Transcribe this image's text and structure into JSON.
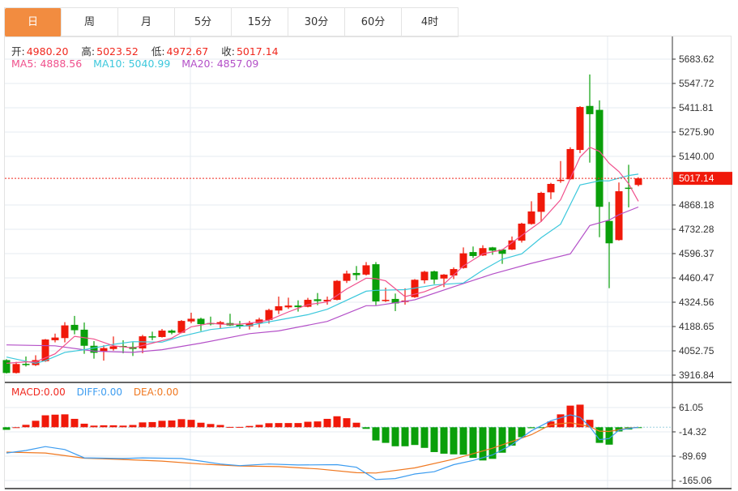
{
  "tabs": [
    {
      "label": "日",
      "active": true
    },
    {
      "label": "周"
    },
    {
      "label": "月"
    },
    {
      "label": "5分"
    },
    {
      "label": "15分"
    },
    {
      "label": "30分"
    },
    {
      "label": "60分"
    },
    {
      "label": "4时"
    }
  ],
  "ohlc_info": {
    "open_label": "开:",
    "open": "4980.20",
    "high_label": "高:",
    "high": "5023.52",
    "low_label": "低:",
    "low": "4972.67",
    "close_label": "收:",
    "close": "5017.14"
  },
  "ma_info": {
    "ma5": "MA5: 4888.56",
    "ma10": "MA10: 5040.99",
    "ma20": "MA20: 4857.09"
  },
  "macd_info": {
    "macd": "MACD:0.00",
    "diff": "DIFF:0.00",
    "dea": "DEA:0.00"
  },
  "colors": {
    "up": "#f0190a",
    "down": "#0a9f0a",
    "ma5": "#f0508c",
    "ma10": "#3cc8dc",
    "ma20": "#b450c8",
    "diff": "#3c9cf0",
    "dea": "#f07820",
    "accent": "#f28c40"
  },
  "chart_data": [
    {
      "type": "candlestick",
      "yticks": [
        "5683.62",
        "5547.72",
        "5411.81",
        "5275.90",
        "5140.00",
        "4868.18",
        "4732.28",
        "4596.37",
        "4460.47",
        "4324.56",
        "4188.65",
        "4052.75",
        "3916.84"
      ],
      "ylim": [
        3916.84,
        5683.62
      ],
      "last_price": "5017.14",
      "ohlc": [
        [
          4001,
          3929,
          4006,
          3926
        ],
        [
          3929,
          3979,
          3991,
          3926
        ],
        [
          3980,
          3973,
          4021,
          3965
        ],
        [
          3973,
          4001,
          4028,
          3968
        ],
        [
          3995,
          4116,
          4119,
          3991
        ],
        [
          4112,
          4127,
          4149,
          4100
        ],
        [
          4124,
          4195,
          4213,
          4100
        ],
        [
          4198,
          4168,
          4248,
          4145
        ],
        [
          4171,
          4081,
          4211,
          4036
        ],
        [
          4081,
          4042,
          4107,
          4009
        ],
        [
          4048,
          4068,
          4084,
          3998
        ],
        [
          4063,
          4078,
          4133,
          4054
        ],
        [
          4080,
          4074,
          4112,
          4039
        ],
        [
          4075,
          4063,
          4101,
          4024
        ],
        [
          4066,
          4134,
          4142,
          4039
        ],
        [
          4134,
          4127,
          4160,
          4112
        ],
        [
          4130,
          4166,
          4175,
          4127
        ],
        [
          4166,
          4154,
          4172,
          4145
        ],
        [
          4154,
          4220,
          4225,
          4151
        ],
        [
          4217,
          4232,
          4266,
          4207
        ],
        [
          4232,
          4202,
          4238,
          4164
        ],
        [
          4208,
          4201,
          4244,
          4195
        ],
        [
          4202,
          4213,
          4220,
          4175
        ],
        [
          4208,
          4195,
          4260,
          4192
        ],
        [
          4198,
          4189,
          4220,
          4176
        ],
        [
          4190,
          4207,
          4220,
          4172
        ],
        [
          4207,
          4228,
          4238,
          4183
        ],
        [
          4225,
          4281,
          4288,
          4205
        ],
        [
          4278,
          4302,
          4356,
          4258
        ],
        [
          4296,
          4306,
          4350,
          4287
        ],
        [
          4306,
          4297,
          4335,
          4272
        ],
        [
          4299,
          4338,
          4349,
          4296
        ],
        [
          4341,
          4331,
          4376,
          4308
        ],
        [
          4329,
          4338,
          4356,
          4311
        ],
        [
          4338,
          4444,
          4448,
          4335
        ],
        [
          4444,
          4485,
          4501,
          4432
        ],
        [
          4488,
          4476,
          4527,
          4448
        ],
        [
          4479,
          4531,
          4549,
          4474
        ],
        [
          4537,
          4329,
          4549,
          4308
        ],
        [
          4331,
          4338,
          4406,
          4326
        ],
        [
          4343,
          4318,
          4373,
          4275
        ],
        [
          4326,
          4334,
          4402,
          4311
        ],
        [
          4353,
          4450,
          4454,
          4349
        ],
        [
          4447,
          4495,
          4500,
          4429
        ],
        [
          4497,
          4451,
          4501,
          4426
        ],
        [
          4457,
          4479,
          4482,
          4409
        ],
        [
          4474,
          4510,
          4519,
          4454
        ],
        [
          4516,
          4598,
          4631,
          4512
        ],
        [
          4605,
          4583,
          4636,
          4572
        ],
        [
          4586,
          4627,
          4643,
          4583
        ],
        [
          4631,
          4613,
          4634,
          4590
        ],
        [
          4619,
          4595,
          4622,
          4539
        ],
        [
          4619,
          4670,
          4692,
          4616
        ],
        [
          4669,
          4764,
          4769,
          4658
        ],
        [
          4762,
          4832,
          4889,
          4758
        ],
        [
          4830,
          4936,
          4942,
          4773
        ],
        [
          4939,
          4986,
          4992,
          4901
        ],
        [
          5003,
          5009,
          5114,
          4992
        ],
        [
          5012,
          5181,
          5191,
          5009
        ],
        [
          5176,
          5416,
          5421,
          5158
        ],
        [
          5422,
          5376,
          5598,
          5105
        ],
        [
          5400,
          4858,
          5453,
          4688
        ],
        [
          4779,
          4654,
          4885,
          4403
        ],
        [
          4672,
          4945,
          4994,
          4669
        ],
        [
          4965,
          4960,
          5093,
          4855
        ],
        [
          4980.2,
          5017.14,
          5023.52,
          4972.67
        ]
      ],
      "ma5": [
        [
          0,
          3983
        ],
        [
          2,
          3991
        ],
        [
          3,
          3991
        ],
        [
          5,
          4036
        ],
        [
          7,
          4134
        ],
        [
          9,
          4119
        ],
        [
          11,
          4081
        ],
        [
          13,
          4069
        ],
        [
          15,
          4096
        ],
        [
          17,
          4124
        ],
        [
          19,
          4187
        ],
        [
          21,
          4207
        ],
        [
          22,
          4202
        ],
        [
          24,
          4202
        ],
        [
          26,
          4214
        ],
        [
          27,
          4225
        ],
        [
          29,
          4270
        ],
        [
          31,
          4311
        ],
        [
          33,
          4326
        ],
        [
          35,
          4399
        ],
        [
          37,
          4459
        ],
        [
          38,
          4456
        ],
        [
          39,
          4444
        ],
        [
          41,
          4356
        ],
        [
          43,
          4383
        ],
        [
          45,
          4426
        ],
        [
          47,
          4527
        ],
        [
          49,
          4595
        ],
        [
          51,
          4617
        ],
        [
          53,
          4698
        ],
        [
          55,
          4776
        ],
        [
          57,
          4897
        ],
        [
          59,
          5136
        ],
        [
          60,
          5191
        ],
        [
          61,
          5168
        ],
        [
          62,
          5101
        ],
        [
          63,
          5055
        ],
        [
          64,
          4987
        ],
        [
          65,
          4889
        ]
      ],
      "ma10": [
        [
          0,
          4018
        ],
        [
          3,
          3983
        ],
        [
          4,
          3998
        ],
        [
          6,
          4044
        ],
        [
          8,
          4059
        ],
        [
          11,
          4089
        ],
        [
          13,
          4104
        ],
        [
          16,
          4101
        ],
        [
          18,
          4134
        ],
        [
          21,
          4172
        ],
        [
          25,
          4195
        ],
        [
          28,
          4225
        ],
        [
          31,
          4255
        ],
        [
          33,
          4285
        ],
        [
          37,
          4386
        ],
        [
          38,
          4391
        ],
        [
          41,
          4395
        ],
        [
          44,
          4421
        ],
        [
          47,
          4432
        ],
        [
          49,
          4504
        ],
        [
          51,
          4565
        ],
        [
          53,
          4595
        ],
        [
          55,
          4685
        ],
        [
          57,
          4761
        ],
        [
          59,
          4980
        ],
        [
          61,
          5003
        ],
        [
          62,
          5003
        ],
        [
          64,
          5033
        ],
        [
          65,
          5041
        ]
      ],
      "ma20": [
        [
          0,
          4086
        ],
        [
          5,
          4081
        ],
        [
          9,
          4051
        ],
        [
          13,
          4044
        ],
        [
          16,
          4059
        ],
        [
          20,
          4096
        ],
        [
          25,
          4149
        ],
        [
          28,
          4164
        ],
        [
          33,
          4217
        ],
        [
          37,
          4305
        ],
        [
          38,
          4305
        ],
        [
          42,
          4338
        ],
        [
          46,
          4411
        ],
        [
          50,
          4482
        ],
        [
          54,
          4542
        ],
        [
          58,
          4595
        ],
        [
          60,
          4753
        ],
        [
          62,
          4784
        ],
        [
          63,
          4814
        ],
        [
          65,
          4857
        ]
      ]
    },
    {
      "type": "macd",
      "yticks": [
        "61.05",
        "-14.32",
        "-89.69",
        "-165.06"
      ],
      "histogram": [
        -8,
        0,
        7.5,
        20,
        37,
        39,
        40,
        26,
        11,
        5,
        6,
        6,
        5,
        7,
        15,
        16,
        20,
        21,
        25,
        23,
        14,
        10,
        7,
        1,
        1,
        4,
        7.5,
        12.5,
        13,
        13,
        13,
        17,
        18,
        26,
        34,
        28,
        14,
        -5,
        -41,
        -48.5,
        -59,
        -59,
        -55,
        -64,
        -77,
        -82,
        -84,
        -85,
        -95,
        -103,
        -98,
        -79,
        -57,
        -31,
        -3,
        -2,
        18,
        40,
        67,
        70,
        23,
        -48.5,
        -54,
        -13,
        -7,
        -2
      ],
      "diff": [
        [
          0,
          -80
        ],
        [
          2,
          -72
        ],
        [
          4,
          -60
        ],
        [
          6,
          -69
        ],
        [
          8,
          -95
        ],
        [
          12,
          -97
        ],
        [
          14,
          -95
        ],
        [
          18,
          -97
        ],
        [
          20,
          -105
        ],
        [
          22,
          -114
        ],
        [
          24,
          -119
        ],
        [
          27,
          -114
        ],
        [
          30,
          -117
        ],
        [
          34,
          -116
        ],
        [
          36,
          -124
        ],
        [
          38,
          -162
        ],
        [
          40,
          -159
        ],
        [
          42,
          -145
        ],
        [
          44,
          -138
        ],
        [
          46,
          -116
        ],
        [
          48,
          -103
        ],
        [
          50,
          -86
        ],
        [
          52,
          -54
        ],
        [
          54,
          -11
        ],
        [
          56,
          20
        ],
        [
          58,
          38.5
        ],
        [
          59,
          31
        ],
        [
          60,
          2
        ],
        [
          61,
          -38.5
        ],
        [
          62,
          -35
        ],
        [
          63,
          -9
        ],
        [
          64,
          -4
        ],
        [
          65,
          0
        ]
      ],
      "dea": [
        [
          0,
          -77
        ],
        [
          4,
          -80
        ],
        [
          8,
          -96
        ],
        [
          12,
          -100
        ],
        [
          16,
          -105
        ],
        [
          20,
          -114
        ],
        [
          24,
          -120
        ],
        [
          28,
          -122
        ],
        [
          32,
          -129
        ],
        [
          36,
          -141
        ],
        [
          38,
          -142
        ],
        [
          42,
          -126
        ],
        [
          46,
          -99
        ],
        [
          50,
          -65
        ],
        [
          54,
          -23
        ],
        [
          56,
          8
        ],
        [
          58,
          14
        ],
        [
          60,
          2
        ],
        [
          61,
          -12
        ],
        [
          62,
          -13
        ],
        [
          64,
          -2.5
        ],
        [
          65,
          0
        ]
      ]
    }
  ]
}
